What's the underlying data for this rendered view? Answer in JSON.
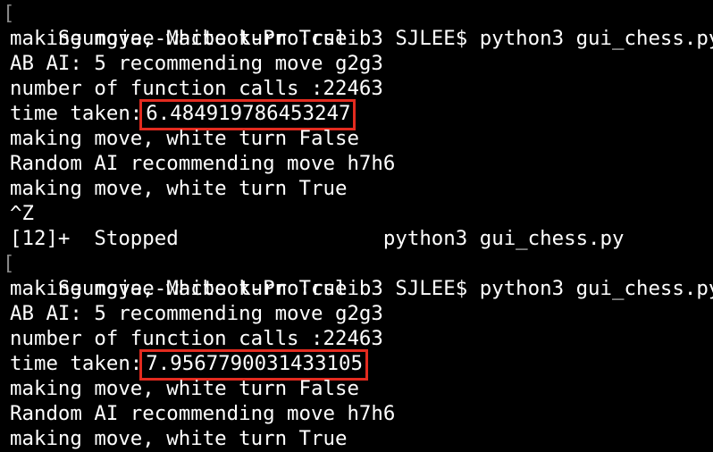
{
  "terminal": {
    "highlight_color": "#e32b1f",
    "background_color": "#000000",
    "text_color": "#ffffff",
    "run1": {
      "prompt": "Seungjae-Macbook-Pro:cslib3 SJLEE$ python3 gui_chess.py",
      "line1": "making move, white turn True",
      "line2": "AB AI: 5 recommending move g2g3",
      "line3": "number of function calls :22463",
      "time_label": "time taken:",
      "time_value": "6.484919786453247",
      "line5": "making move, white turn False",
      "line6": "Random AI recommending move h7h6",
      "line7": "making move, white turn True",
      "interrupt": "^Z",
      "job_status": "[12]+  Stopped                 python3 gui_chess.py"
    },
    "run2": {
      "prompt": "Seungjae-Macbook-Pro:cslib3 SJLEE$ python3 gui_chess.py",
      "line1": "making move, white turn True",
      "line2": "AB AI: 5 recommending move g2g3",
      "line3": "number of function calls :22463",
      "time_label": "time taken:",
      "time_value": "7.9567790031433105",
      "line5": "making move, white turn False",
      "line6": "Random AI recommending move h7h6",
      "line7": "making move, white turn True"
    }
  }
}
